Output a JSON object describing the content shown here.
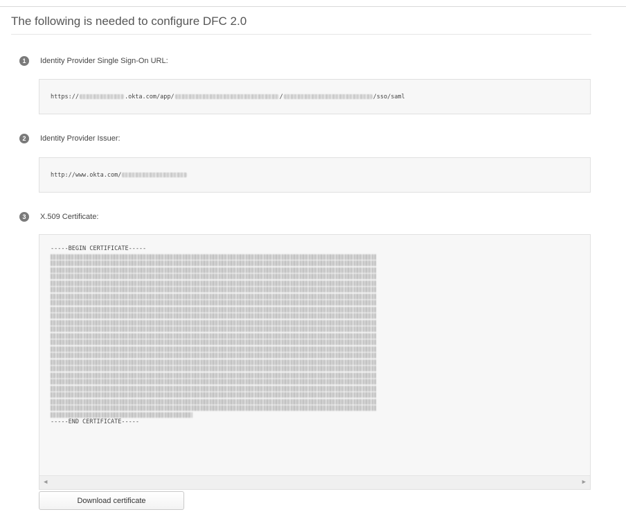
{
  "header": {
    "title": "The following is needed to configure DFC 2.0"
  },
  "steps": [
    {
      "number": "1",
      "label": "Identity Provider Single Sign-On URL:",
      "value_prefix": "https://",
      "value_middle1": ".okta.com/app/",
      "value_middle2": "/",
      "value_suffix": "/sso/saml"
    },
    {
      "number": "2",
      "label": "Identity Provider Issuer:",
      "value_prefix": "http://www.okta.com/"
    },
    {
      "number": "3",
      "label": "X.509 Certificate:",
      "cert_begin": "-----BEGIN CERTIFICATE-----",
      "cert_end": "-----END CERTIFICATE-----"
    }
  ],
  "scrollbar": {
    "left_arrow": "◀",
    "right_arrow": "▶"
  },
  "actions": {
    "download_label": "Download certificate"
  }
}
